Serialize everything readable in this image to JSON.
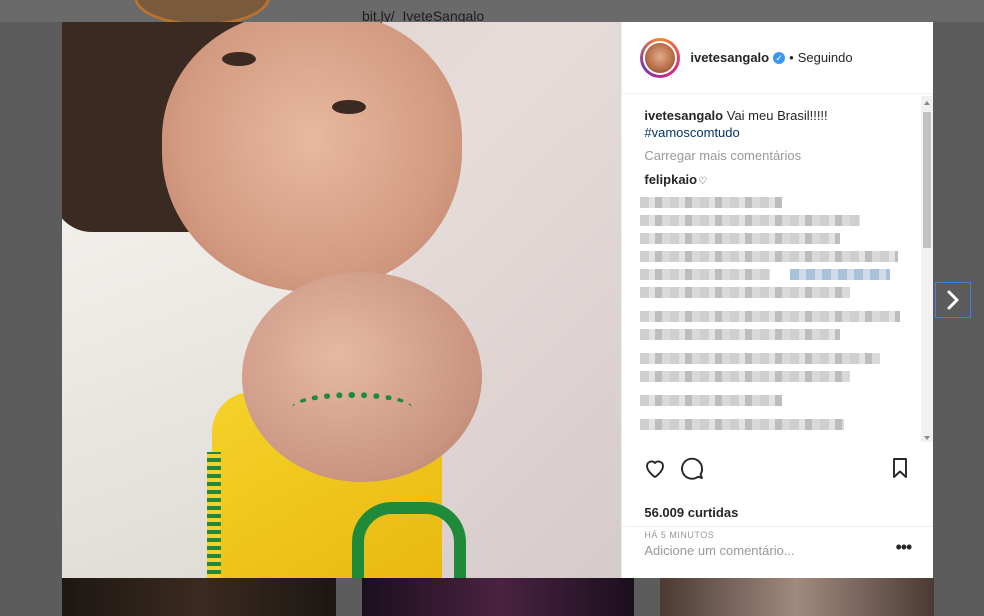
{
  "background": {
    "link_text": "bit.ly/_IveteSangalo"
  },
  "post": {
    "username": "ivetesangalo",
    "separator": "•",
    "follow_status": "Seguindo",
    "caption_username": "ivetesangalo",
    "caption_text": "Vai meu Brasil!!!!!",
    "hashtag": "#vamoscomtudo",
    "load_more": "Carregar mais comentários",
    "commenter": "felipkaio",
    "commenter_heart": "♡",
    "likes": "56.009 curtidas",
    "time_ago": "HÁ 5 MINUTOS",
    "comment_placeholder": "Adicione um comentário...",
    "more_options": "•••"
  },
  "icons": {
    "verified": "verified-badge-icon",
    "like": "heart-icon",
    "comment": "comment-bubble-icon",
    "save": "bookmark-icon",
    "next": "chevron-right-icon"
  },
  "colors": {
    "verified": "#3897f0",
    "hashtag": "#003569",
    "muted": "#999999",
    "focus": "#3e84d6"
  }
}
